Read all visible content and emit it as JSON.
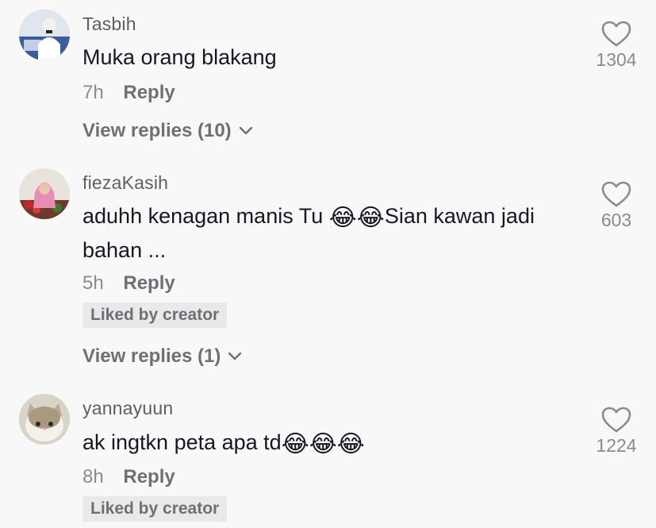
{
  "comments": [
    {
      "username": "Tasbih",
      "text": "Muka orang blakang",
      "time": "7h",
      "reply_label": "Reply",
      "view_replies": "View replies (10)",
      "likes": "1304"
    },
    {
      "username": "fiezaKasih",
      "text_part1": "aduhh kenagan manis Tu ",
      "emojis_1": "😂😂",
      "text_part2": "Sian kawan jadi bahan ...",
      "time": "5h",
      "reply_label": "Reply",
      "badge": "Liked by creator",
      "view_replies": "View replies (1)",
      "likes": "603"
    },
    {
      "username": "yannayuun",
      "text_part1": "ak ingtkn peta apa td",
      "emojis_1": "😂😂😂",
      "time": "8h",
      "reply_label": "Reply",
      "badge": "Liked by creator",
      "likes": "1224"
    }
  ],
  "icons": {
    "like": "heart-outline-icon",
    "expand": "chevron-down-icon"
  },
  "colors": {
    "background": "#f8f8f8",
    "username": "#5d5f66",
    "secondary": "#8a8b91",
    "badge_bg": "#e9e9ea"
  }
}
